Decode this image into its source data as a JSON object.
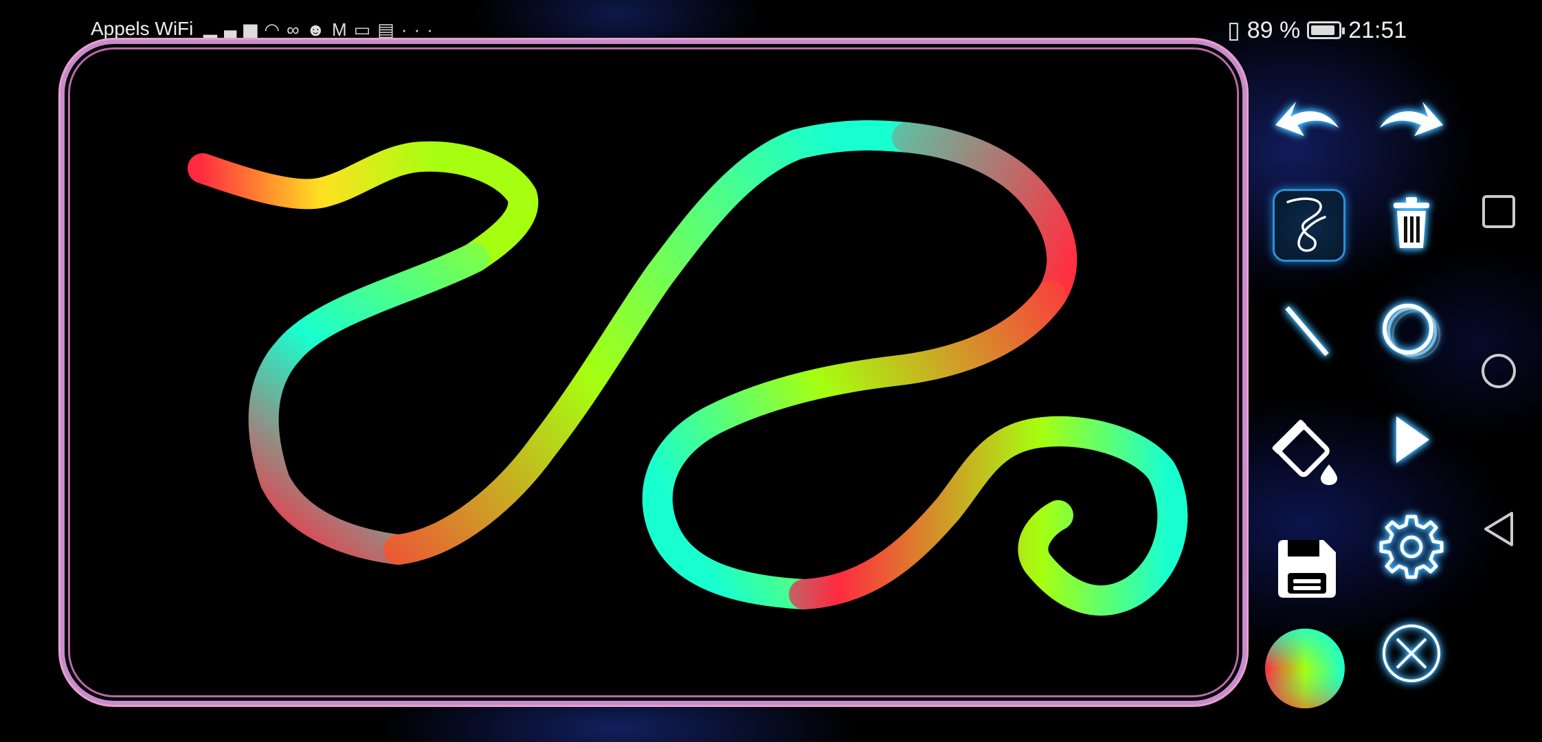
{
  "status_bar": {
    "carrier": "Appels WiFi",
    "battery_percent": "89 %",
    "battery_level": 0.89,
    "time": "21:51"
  },
  "canvas": {
    "stroke_colors": [
      "#ff2a40",
      "#ffe020",
      "#a6ff10",
      "#18ffd0",
      "#ff3040"
    ]
  },
  "toolbar": {
    "tools": [
      {
        "name": "undo",
        "icon": "undo-arrow-icon"
      },
      {
        "name": "redo",
        "icon": "redo-arrow-icon"
      },
      {
        "name": "freehand",
        "icon": "freehand-squiggle-icon",
        "active": true
      },
      {
        "name": "clear",
        "icon": "trash-icon"
      },
      {
        "name": "line",
        "icon": "straight-line-icon"
      },
      {
        "name": "circle",
        "icon": "circle-shape-icon"
      },
      {
        "name": "fill",
        "icon": "paint-bucket-icon"
      },
      {
        "name": "play",
        "icon": "play-triangle-icon"
      },
      {
        "name": "save",
        "icon": "floppy-disk-icon"
      },
      {
        "name": "settings",
        "icon": "gear-icon"
      },
      {
        "name": "color",
        "icon": "rainbow-color-icon"
      },
      {
        "name": "close",
        "icon": "close-x-icon"
      }
    ]
  },
  "nav_bar": {
    "recents": "square-recents-icon",
    "home": "circle-home-icon",
    "back": "triangle-back-icon"
  }
}
